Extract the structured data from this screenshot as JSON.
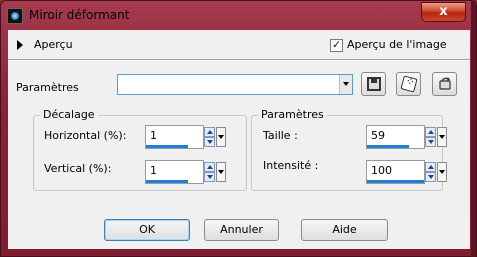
{
  "window": {
    "title": "Miroir déformant",
    "close_symbol": "x",
    "app_icon": "paint-shop-pro-icon"
  },
  "preview": {
    "label": "Aperçu",
    "image_preview_label": "Aperçu de l'image",
    "image_preview_checked": true
  },
  "presets": {
    "label": "Paramètres",
    "value": "",
    "icons": [
      "save-icon",
      "randomize-icon",
      "reset-icon"
    ]
  },
  "offset_group": {
    "title": "Décalage",
    "horizontal_label": "Horizontal (%):",
    "horizontal_value": "1",
    "vertical_label": "Vertical (%):",
    "vertical_value": "1"
  },
  "params_group": {
    "title": "Paramètres",
    "size_label": "Taille :",
    "size_value": "59",
    "intensity_label": "Intensité :",
    "intensity_value": "100"
  },
  "buttons": {
    "ok": "OK",
    "cancel": "Annuler",
    "help": "Aide"
  },
  "colors": {
    "titlebar": "#8b2236",
    "accent": "#1f7fd6",
    "close_button": "#c84a2f"
  }
}
